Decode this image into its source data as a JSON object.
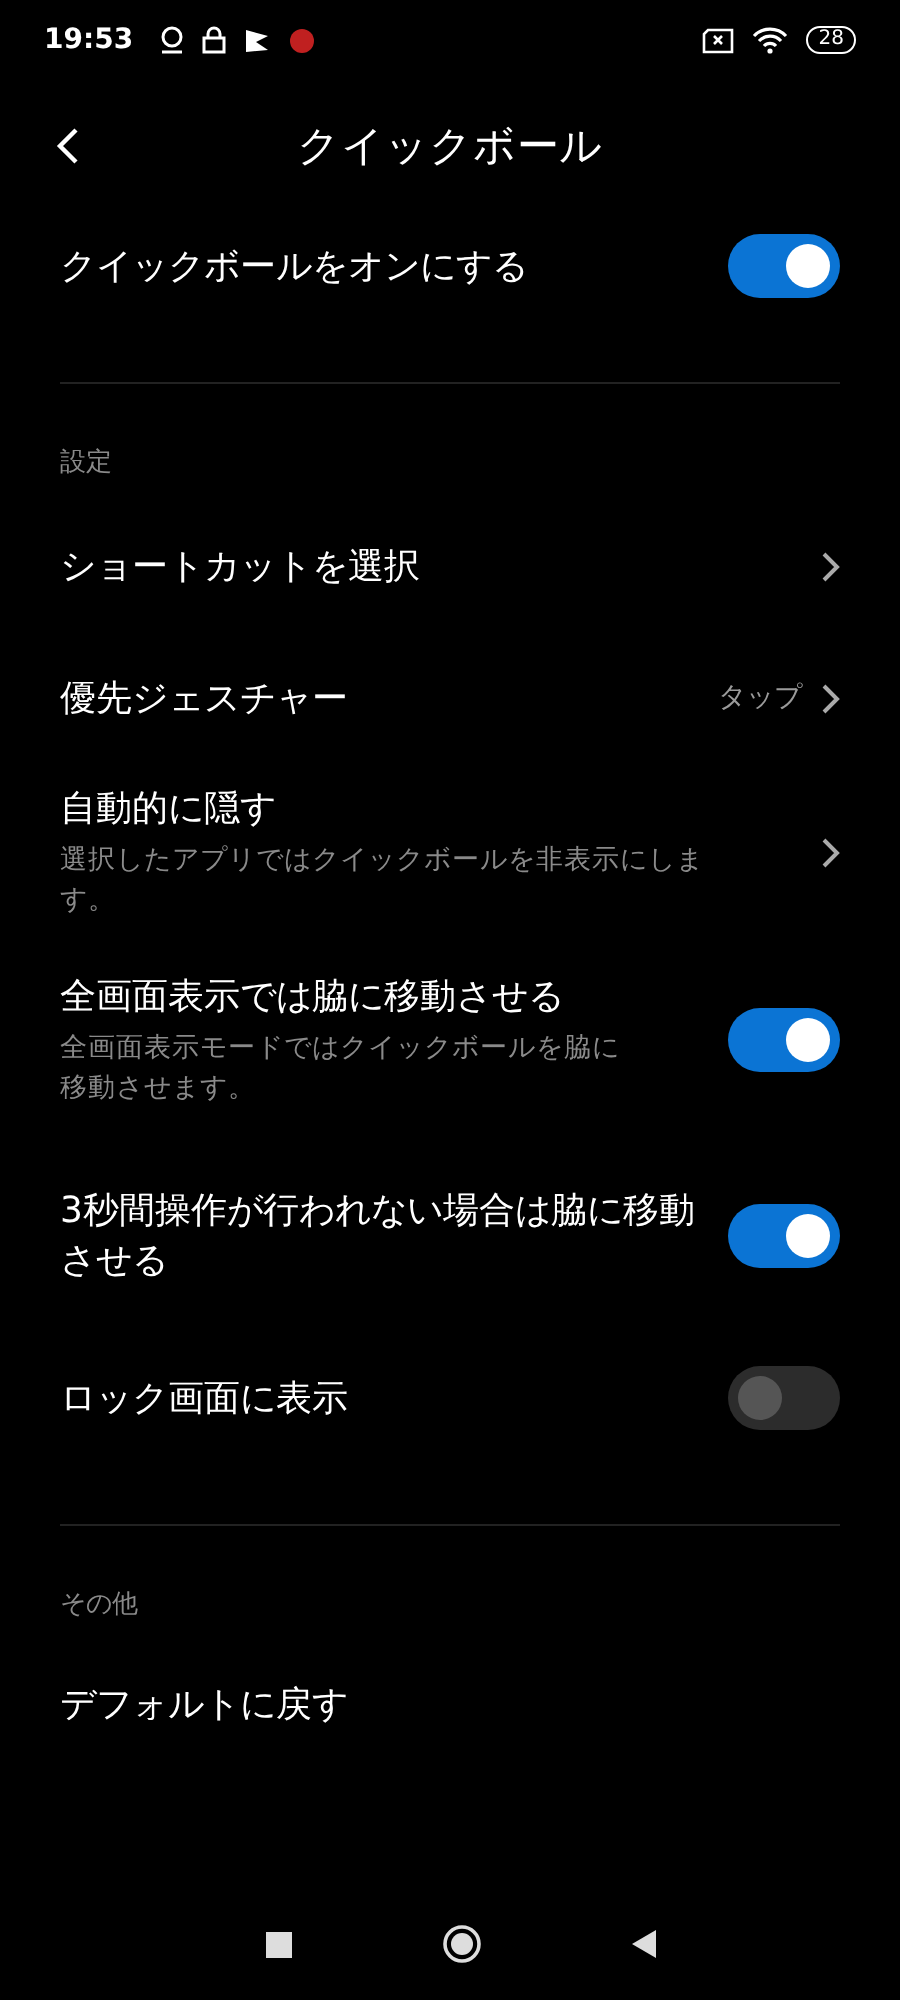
{
  "status_bar": {
    "time": "19:53",
    "battery": "28"
  },
  "header": {
    "title": "クイックボール"
  },
  "main_toggle": {
    "label": "クイックボールをオンにする",
    "on": true
  },
  "sections": [
    {
      "heading": "設定",
      "items": [
        {
          "kind": "link",
          "title": "ショートカットを選択"
        },
        {
          "kind": "link",
          "title": "優先ジェスチャー",
          "value": "タップ"
        },
        {
          "kind": "link",
          "title": "自動的に隠す",
          "subtitle": "選択したアプリではクイックボールを非表示にします。"
        },
        {
          "kind": "toggle",
          "title": "全画面表示では脇に移動させる",
          "subtitle": "全画面表示モードではクイックボールを脇に移動させます。",
          "on": true
        },
        {
          "kind": "toggle",
          "title": "3秒間操作が行われない場合は脇に移動させる",
          "on": true
        },
        {
          "kind": "toggle",
          "title": "ロック画面に表示",
          "on": false
        }
      ]
    },
    {
      "heading": "その他",
      "items": [
        {
          "kind": "link",
          "title": "デフォルトに戻す",
          "chevron": false
        }
      ]
    }
  ]
}
